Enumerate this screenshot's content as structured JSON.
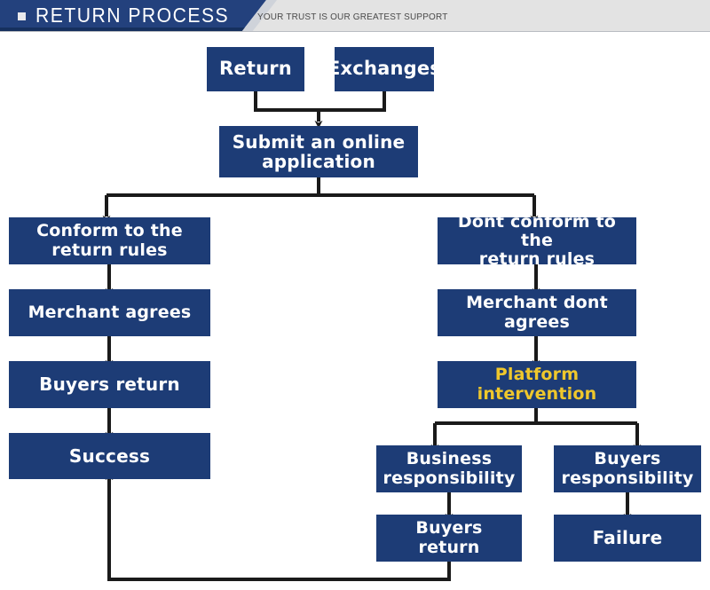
{
  "header": {
    "title": "RETURN PROCESS",
    "subtitle": "YOUR TRUST IS OUR GREATEST SUPPORT",
    "bullet_icon": "square-bullet-icon",
    "navy": "#23417d",
    "band": "#e3e3e3"
  },
  "theme": {
    "node_fill": "#1d3c76",
    "node_text": "#ffffff",
    "highlight_text": "#efc72c",
    "connector": "#1a1a1a",
    "background": "#ffffff"
  },
  "chart_data": {
    "type": "diagram",
    "title": "RETURN PROCESS",
    "nodes": [
      {
        "id": "return",
        "label": "Return",
        "highlight": false
      },
      {
        "id": "exchanges",
        "label": "Exchanges",
        "highlight": false
      },
      {
        "id": "submit",
        "label": "Submit an online\napplication",
        "highlight": false
      },
      {
        "id": "conform",
        "label": "Conform to the\nreturn rules",
        "highlight": false
      },
      {
        "id": "dont-conform",
        "label": "Dont conform to the\nreturn rules",
        "highlight": false
      },
      {
        "id": "merchant-agrees",
        "label": "Merchant agrees",
        "highlight": false
      },
      {
        "id": "merchant-dont",
        "label": "Merchant dont agrees",
        "highlight": false
      },
      {
        "id": "buyers-return-l",
        "label": "Buyers return",
        "highlight": false
      },
      {
        "id": "platform",
        "label": "Platform\nintervention",
        "highlight": true
      },
      {
        "id": "success",
        "label": "Success",
        "highlight": false
      },
      {
        "id": "business-resp",
        "label": "Business\nresponsibility",
        "highlight": false
      },
      {
        "id": "buyers-resp",
        "label": "Buyers\nresponsibility",
        "highlight": false
      },
      {
        "id": "buyers-return-r",
        "label": "Buyers\nreturn",
        "highlight": false
      },
      {
        "id": "failure",
        "label": "Failure",
        "highlight": false
      }
    ],
    "edges": [
      {
        "from": "return",
        "to": "submit"
      },
      {
        "from": "exchanges",
        "to": "submit"
      },
      {
        "from": "submit",
        "to": "conform"
      },
      {
        "from": "submit",
        "to": "dont-conform"
      },
      {
        "from": "conform",
        "to": "merchant-agrees"
      },
      {
        "from": "merchant-agrees",
        "to": "buyers-return-l"
      },
      {
        "from": "buyers-return-l",
        "to": "success"
      },
      {
        "from": "dont-conform",
        "to": "merchant-dont"
      },
      {
        "from": "merchant-dont",
        "to": "platform"
      },
      {
        "from": "platform",
        "to": "business-resp"
      },
      {
        "from": "platform",
        "to": "buyers-resp"
      },
      {
        "from": "business-resp",
        "to": "buyers-return-r"
      },
      {
        "from": "buyers-resp",
        "to": "failure"
      },
      {
        "from": "buyers-return-r",
        "to": "success"
      }
    ]
  }
}
